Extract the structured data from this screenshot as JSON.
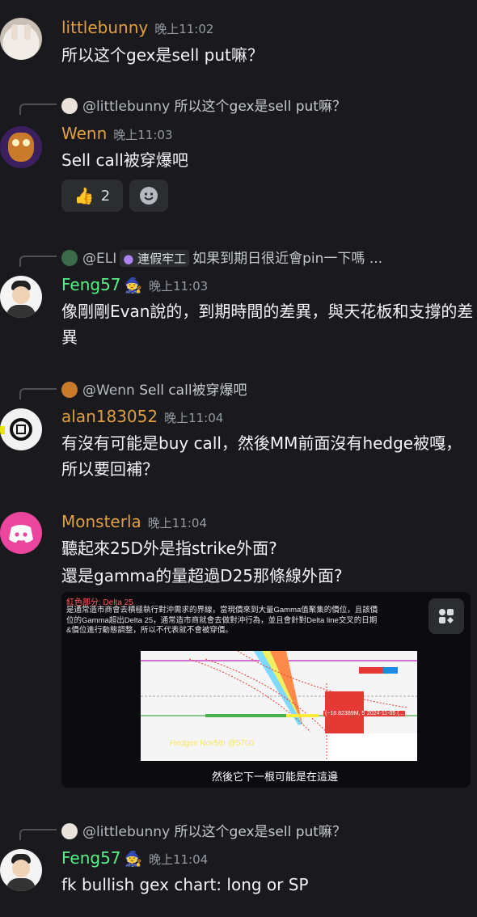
{
  "messages": [
    {
      "name": "littlebunny",
      "name_color": "#e0a042",
      "time": "晚上11:02",
      "text": "所以这个gex是sell put嘛？"
    },
    {
      "reply": {
        "who": "@littlebunny",
        "text": "所以这个gex是sell put嘛？"
      },
      "name": "Wenn",
      "name_color": "#e0a042",
      "time": "晚上11:03",
      "text": "Sell call被穿爆吧",
      "reactions": [
        {
          "emoji": "👍",
          "count": "2"
        },
        {
          "emoji": "add-reaction"
        }
      ]
    },
    {
      "reply": {
        "who": "@ELI",
        "tag": "連假牢工",
        "text": "如果到期日很近會pin一下嗎 ..."
      },
      "name": "Feng57",
      "name_color": "#57f287",
      "time": "晚上11:03",
      "text": "像剛剛Evan說的，到期時間的差異，與天花板和支撐的差異"
    },
    {
      "reply": {
        "who": "@Wenn",
        "text": "Sell call被穿爆吧"
      },
      "name": "alan183052",
      "name_color": "#e0a042",
      "time": "晚上11:04",
      "text": "有沒有可能是buy call，然後MM前面沒有hedge被嘎，所以要回補？"
    },
    {
      "name": "Monsterla",
      "name_color": "#e0a042",
      "time": "晚上11:04",
      "text1": "聽起來25D外是指strike外面?",
      "text2": "還是gamma的量超過D25那條線外面?",
      "image": {
        "header": "紅色部分: Delta 25",
        "para": "是通常造市商會去積極執行對沖需求的界線，當現價來到大量Gamma值聚集的價位，且該價位的Gamma超出Delta 25，通常造市商就會去做對沖行為，並且會針對Delta line交叉的日期&價位進行動態調整，所以不代表就不會被穿價。",
        "hedges": "Hedges Nov5th @5700",
        "caption": "然後它下一根可能是在這邊",
        "label_price": "(~18.82389M, 5700)",
        "label_date": "2024-11-05 (..."
      }
    },
    {
      "reply": {
        "who": "@littlebunny",
        "text": "所以这个gex是sell put嘛？"
      },
      "name": "Feng57",
      "name_color": "#57f287",
      "time": "晚上11:04",
      "text": "fk bullish gex chart: long or SP"
    }
  ]
}
